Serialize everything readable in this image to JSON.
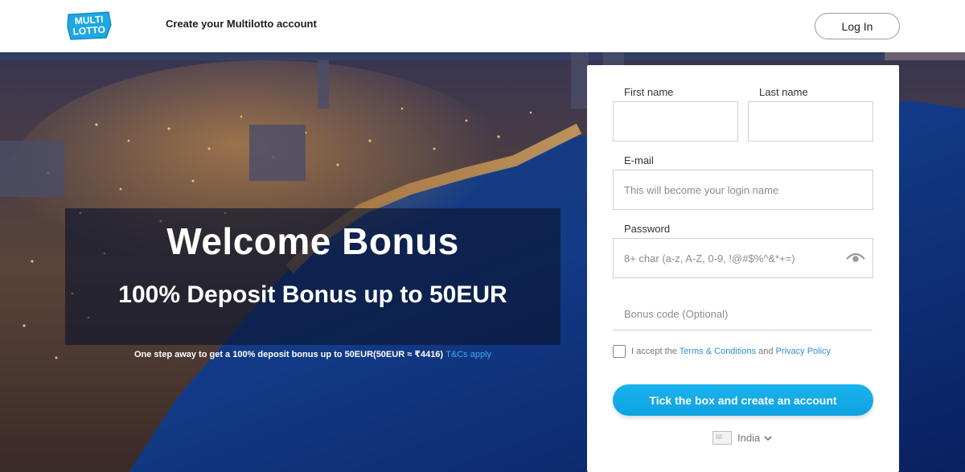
{
  "header": {
    "title": "Create your Multilotto account",
    "login_label": "Log In",
    "logo_text_top": "MULTI",
    "logo_text_bottom": "LOTTO"
  },
  "hero": {
    "title": "Welcome Bonus",
    "subtitle": "100% Deposit Bonus up to 50EUR",
    "note": "One step away to get a 100% deposit bonus up to 50EUR(50EUR ≈ ₹4416)",
    "tc_link": "T&Cs apply"
  },
  "form": {
    "first_name_label": "First name",
    "last_name_label": "Last name",
    "email_label": "E-mail",
    "email_placeholder": "This will become your login name",
    "password_label": "Password",
    "password_placeholder": "8+ char (a-z, A-Z, 0-9, !@#$%^&*+=)",
    "bonus_placeholder": "Bonus code (Optional)",
    "terms_prefix": "I accept the",
    "terms_link": "Terms & Conditions",
    "terms_and": "and",
    "privacy_link": "Privacy Policy",
    "submit_label": "Tick the box and create an account",
    "country": "India"
  },
  "colors": {
    "accent": "#0ea2e1",
    "link": "#2b8fd5",
    "logo_blue": "#1ea7e3"
  },
  "icons": [
    "eye-icon",
    "chevron-down-icon",
    "flag-icon",
    "logo"
  ]
}
